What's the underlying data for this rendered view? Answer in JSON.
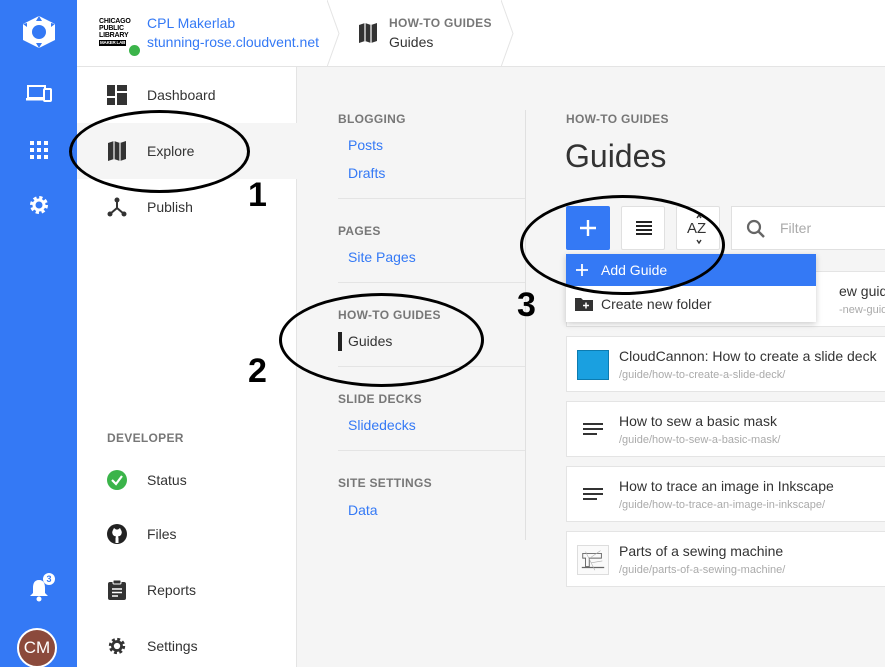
{
  "rail": {
    "items": [
      "cloudcannon-logo-icon",
      "devices-icon",
      "apps-grid-icon",
      "gear-icon"
    ],
    "notification_count": "3",
    "avatar_initials": "CM"
  },
  "topbar": {
    "site_name": "CPL Makerlab",
    "site_domain": "stunning-rose.cloudvent.net",
    "logo_lines": [
      "CHICAGO",
      "PUBLIC",
      "LIBRARY",
      "MAKER LAB"
    ],
    "breadcrumb_section": "HOW-TO GUIDES",
    "breadcrumb_page": "Guides"
  },
  "nav": {
    "items": [
      {
        "label": "Dashboard",
        "icon": "dashboard-icon"
      },
      {
        "label": "Explore",
        "icon": "map-icon"
      },
      {
        "label": "Publish",
        "icon": "publish-icon"
      }
    ],
    "developer_title": "DEVELOPER",
    "developer_items": [
      {
        "label": "Status",
        "icon": "status-check-icon"
      },
      {
        "label": "Files",
        "icon": "github-icon"
      },
      {
        "label": "Reports",
        "icon": "clipboard-icon"
      },
      {
        "label": "Settings",
        "icon": "gear-icon"
      }
    ]
  },
  "collections": {
    "groups": [
      {
        "title": "BLOGGING",
        "links": [
          "Posts",
          "Drafts"
        ]
      },
      {
        "title": "PAGES",
        "links": [
          "Site Pages"
        ]
      },
      {
        "title": "HOW-TO GUIDES",
        "links": [
          "Guides"
        ]
      },
      {
        "title": "SLIDE DECKS",
        "links": [
          "Slidedecks"
        ]
      },
      {
        "title": "SITE SETTINGS",
        "links": [
          "Data"
        ]
      }
    ]
  },
  "main": {
    "section": "HOW-TO GUIDES",
    "title": "Guides",
    "sort_label": "AZ",
    "filter_placeholder": "Filter",
    "dropdown": {
      "add_label": "Add Guide",
      "folder_label": "Create new folder"
    },
    "guides": [
      {
        "title": "ew guide",
        "path": "-new-guide/",
        "thumb": "none"
      },
      {
        "title": "CloudCannon: How to create a slide deck",
        "path": "/guide/how-to-create-a-slide-deck/",
        "thumb": "slide-thumbnail"
      },
      {
        "title": "How to sew a basic mask",
        "path": "/guide/how-to-sew-a-basic-mask/",
        "thumb": "text-lines-icon"
      },
      {
        "title": "How to trace an image in Inkscape",
        "path": "/guide/how-to-trace-an-image-in-inkscape/",
        "thumb": "text-lines-icon"
      },
      {
        "title": "Parts of a sewing machine",
        "path": "/guide/parts-of-a-sewing-machine/",
        "thumb": "sewing-machine-thumbnail"
      }
    ]
  },
  "annotations": {
    "one": "1",
    "two": "2",
    "three": "3"
  },
  "colors": {
    "accent": "#3479f5",
    "rail": "#3479f5",
    "status_green": "#3bb44a",
    "avatar": "#8b4a3c"
  }
}
